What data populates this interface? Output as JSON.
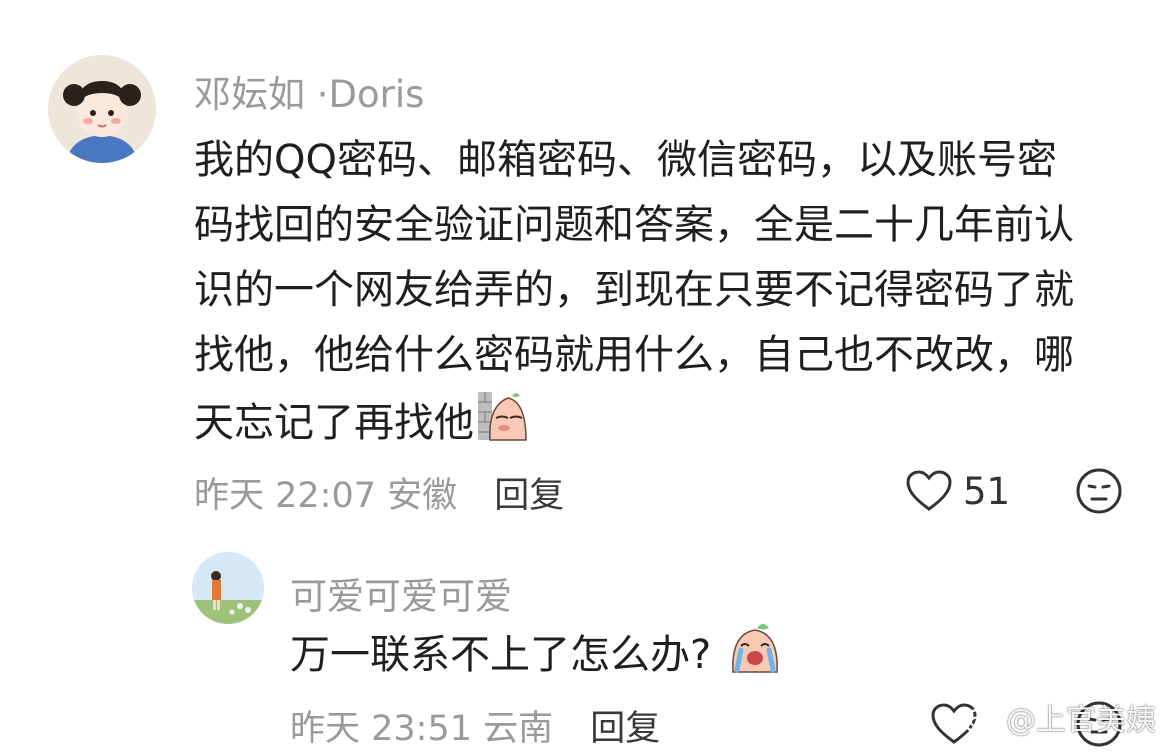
{
  "comment_main": {
    "username": "邓妘如 ·Doris",
    "text_lines": [
      "我的QQ密码、邮箱密码、微信密码，以及账号密",
      "码找回的安全验证问题和答案，全是二十几年前认",
      "识的一个网友给弄的，到现在只要不记得密码了就",
      "找他，他给什么密码就用什么，自己也不改改，哪",
      "天忘记了再找他"
    ],
    "sticker_icon": "peek-behind-wall-sticker",
    "time": "昨天 22:07",
    "location": "安徽",
    "reply_label": "回复",
    "like_count": "51",
    "like_icon": "heart-outline-icon",
    "reaction_icon": "meh-face-icon"
  },
  "comment_reply": {
    "username": "可爱可爱可爱",
    "text": "万一联系不上了怎么办?",
    "sticker_icon": "crying-sticker",
    "time": "昨天 23:51",
    "location": "云南",
    "reply_label": "回复",
    "like_icon": "heart-outline-icon",
    "reaction_icon": "meh-face-icon"
  },
  "watermark": {
    "text": "@上官美姨",
    "icon": "weibo-logo-icon"
  }
}
